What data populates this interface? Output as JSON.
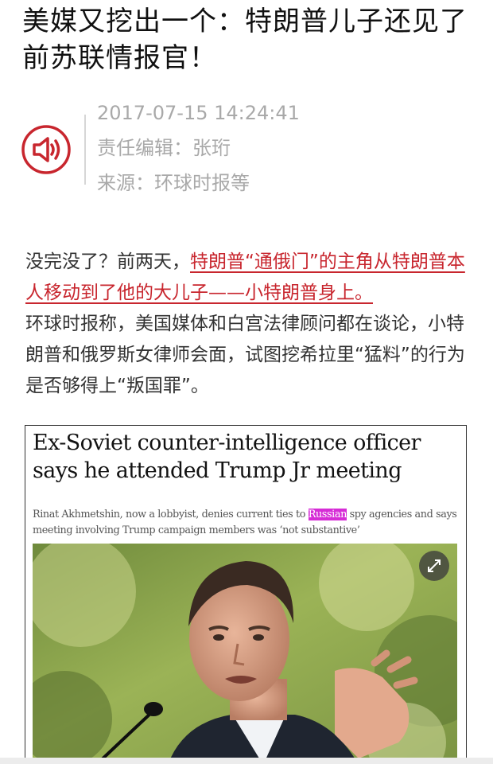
{
  "article": {
    "title": "美媒又挖出一个：特朗普儿子还见了前苏联情报官！",
    "datetime": "2017-07-15 14:24:41",
    "editor": "责任编辑：张珩",
    "source": "来源：环球时报等",
    "audio_icon": "speaker-icon",
    "intro_before": "没完没了？前两天，",
    "intro_link": "特朗普“通俄门”的主角从特朗普本人移动到了他的大儿子——小特朗普身上。",
    "intro_after": "环球时报称，美国媒体和白宫法律顾问都在谈论，小特朗普和俄罗斯女律师会面，试图挖希拉里“猛料”的行为是否够得上“叛国罪”。"
  },
  "image_clip": {
    "headline": "Ex-Soviet counter-intelligence officer says he attended Trump Jr meeting",
    "standfirst_before": "Rinat Akhmetshin, now a lobbyist, denies current ties to ",
    "standfirst_highlight": "Russian",
    "standfirst_after": " spy agencies and says meeting involving Trump campaign members was ‘not substantive’",
    "expand_icon": "expand-arrows-icon"
  },
  "colors": {
    "accent": "#c8262e",
    "meta_text": "#a9a9a9",
    "highlight": "#d62cd6"
  }
}
